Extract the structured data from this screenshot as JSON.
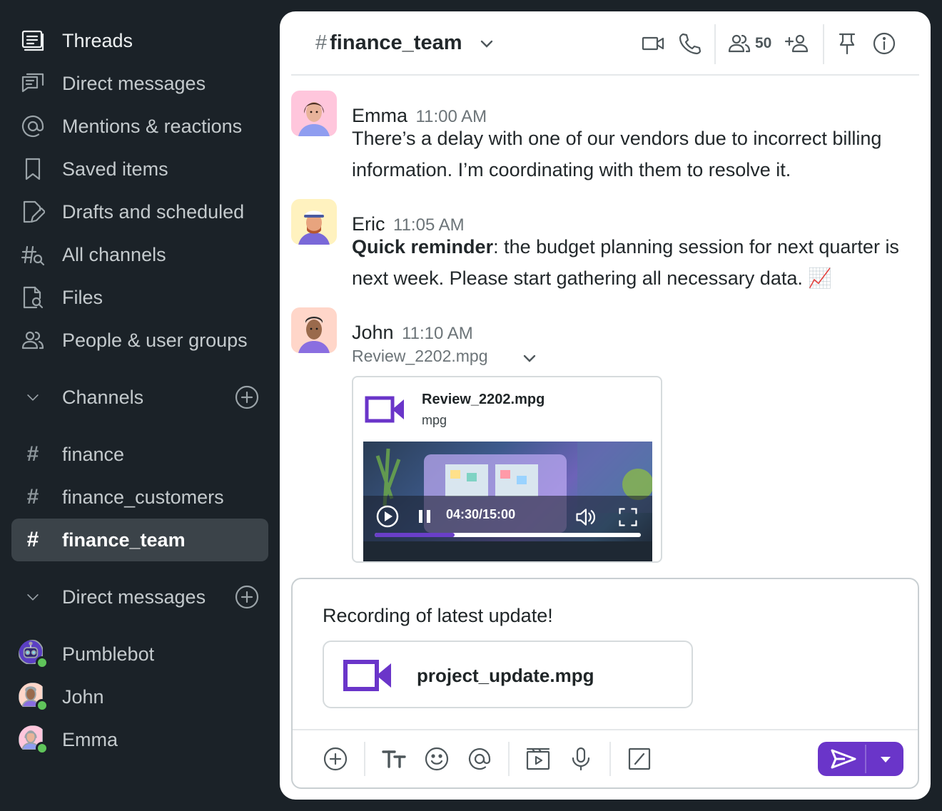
{
  "sidebar": {
    "nav": [
      {
        "label": "Threads",
        "icon": "threads-icon"
      },
      {
        "label": "Direct messages",
        "icon": "direct-messages-icon"
      },
      {
        "label": "Mentions & reactions",
        "icon": "at-icon"
      },
      {
        "label": "Saved items",
        "icon": "bookmark-icon"
      },
      {
        "label": "Drafts and scheduled",
        "icon": "draft-icon"
      },
      {
        "label": "All channels",
        "icon": "channel-search-icon"
      },
      {
        "label": "Files",
        "icon": "file-search-icon"
      },
      {
        "label": "People & user groups",
        "icon": "people-icon"
      }
    ],
    "channels_header": "Channels",
    "channels": [
      "finance",
      "finance_customers",
      "finance_team"
    ],
    "active_channel": "finance_team",
    "dm_header": "Direct messages",
    "dms": [
      "Pumblebot",
      "John",
      "Emma"
    ]
  },
  "header": {
    "channel_name": "finance_team",
    "member_count": "50"
  },
  "messages": [
    {
      "author": "Emma",
      "time": "11:00 AM",
      "text": "There’s a delay with one of our vendors due to incorrect billing information. I’m coordinating with them to resolve it."
    },
    {
      "author": "Eric",
      "time": "11:05 AM",
      "bold": "Quick reminder",
      "text": ": the budget planning session for next quarter is next week. Please start gathering all necessary data. 📈"
    },
    {
      "author": "John",
      "time": "11:10 AM",
      "file_label": "Review_2202.mpg",
      "file": {
        "name": "Review_2202.mpg",
        "type": "mpg",
        "time": "04:30/15:00",
        "progress": 0.3
      }
    }
  ],
  "composer": {
    "text": "Recording of latest update!",
    "attachment": "project_update.mpg"
  },
  "colors": {
    "sidebar_bg": "#1b2228",
    "accent": "#6a35c9",
    "online": "#5fc45a"
  }
}
